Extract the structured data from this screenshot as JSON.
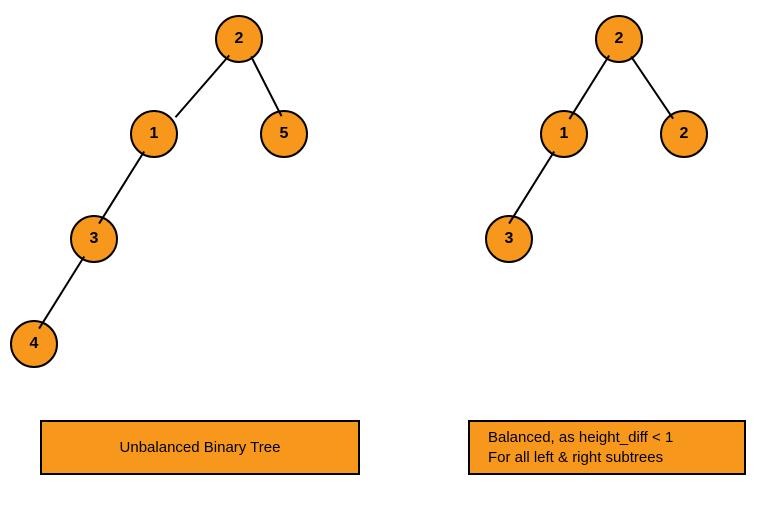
{
  "left_tree": {
    "nodes": {
      "root": "2",
      "l": "1",
      "r": "5",
      "ll": "3",
      "lll": "4"
    },
    "caption": "Unbalanced Binary Tree"
  },
  "right_tree": {
    "nodes": {
      "root": "2",
      "l": "1",
      "r": "2",
      "ll": "3"
    },
    "caption": "Balanced, as height_diff < 1\nFor all left & right subtrees"
  },
  "colors": {
    "node_fill": "#f7981d",
    "stroke": "#000000"
  },
  "chart_data": [
    {
      "type": "tree",
      "title": "Unbalanced Binary Tree",
      "root": {
        "v": 2,
        "left": {
          "v": 1,
          "left": {
            "v": 3,
            "left": {
              "v": 4
            }
          }
        },
        "right": {
          "v": 5
        }
      }
    },
    {
      "type": "tree",
      "title": "Balanced, as height_diff < 1 For all left & right subtrees",
      "root": {
        "v": 2,
        "left": {
          "v": 1,
          "left": {
            "v": 3
          }
        },
        "right": {
          "v": 2
        }
      }
    }
  ]
}
